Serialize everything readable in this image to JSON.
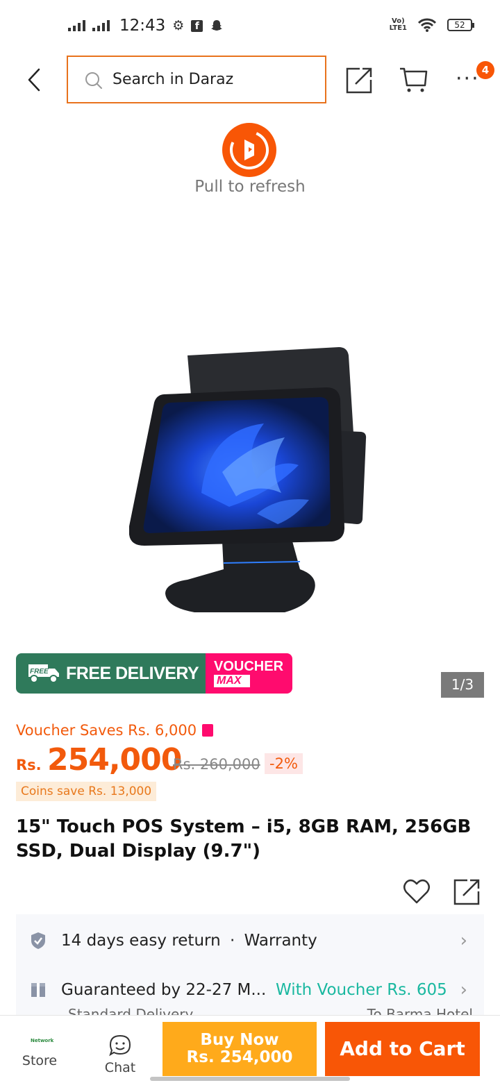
{
  "status_bar": {
    "time": "12:43",
    "volte": "VoLTE1",
    "battery": "52",
    "icons": [
      "signal-icon",
      "signal-icon",
      "gear-icon",
      "facebook-icon",
      "snapchat-icon",
      "wifi-icon",
      "battery-icon"
    ]
  },
  "header": {
    "search_placeholder": "Search in Daraz",
    "cart_badge": "4",
    "icons": [
      "back-arrow-icon",
      "search-icon",
      "share-icon",
      "cart-icon",
      "more-icon"
    ]
  },
  "refresh": {
    "text": "Pull to refresh"
  },
  "gallery": {
    "counter": "1/3",
    "promo_free_tag": "FREE",
    "promo_label": "FREE DELIVERY",
    "promo_voucher_1": "VOUCHER",
    "promo_voucher_2": "MAX"
  },
  "price": {
    "voucher_saves": "Voucher Saves Rs. 6,000",
    "currency": "Rs.",
    "current": "254,000",
    "original": "Rs. 260,000",
    "discount": "-2%",
    "coins": "Coins save Rs. 13,000"
  },
  "product": {
    "title": "15\" Touch POS System – i5, 8GB RAM, 256GB SSD, Dual Display (9.7\")"
  },
  "service": {
    "return_text": "14 days easy return",
    "separator": "·",
    "warranty": "Warranty",
    "delivery_text": "Guaranteed by 22-27 M...",
    "voucher_text": "With Voucher Rs. 605",
    "delivery_type": "Standard Delivery",
    "destination": "To Barma Hotel"
  },
  "bottom_bar": {
    "store_logo": "Network",
    "store_label": "Store",
    "chat_label": "Chat",
    "buy_now_line1": "Buy Now",
    "buy_now_line2": "Rs. 254,000",
    "add_to_cart": "Add to Cart"
  },
  "colors": {
    "brand_orange": "#f85606",
    "price_orange": "#f25a0c",
    "buy_now_yellow": "#ffaa1b",
    "delivery_green": "#2f7a5b",
    "voucher_pink": "#ff0b6e",
    "teal": "#1ab8a0"
  }
}
